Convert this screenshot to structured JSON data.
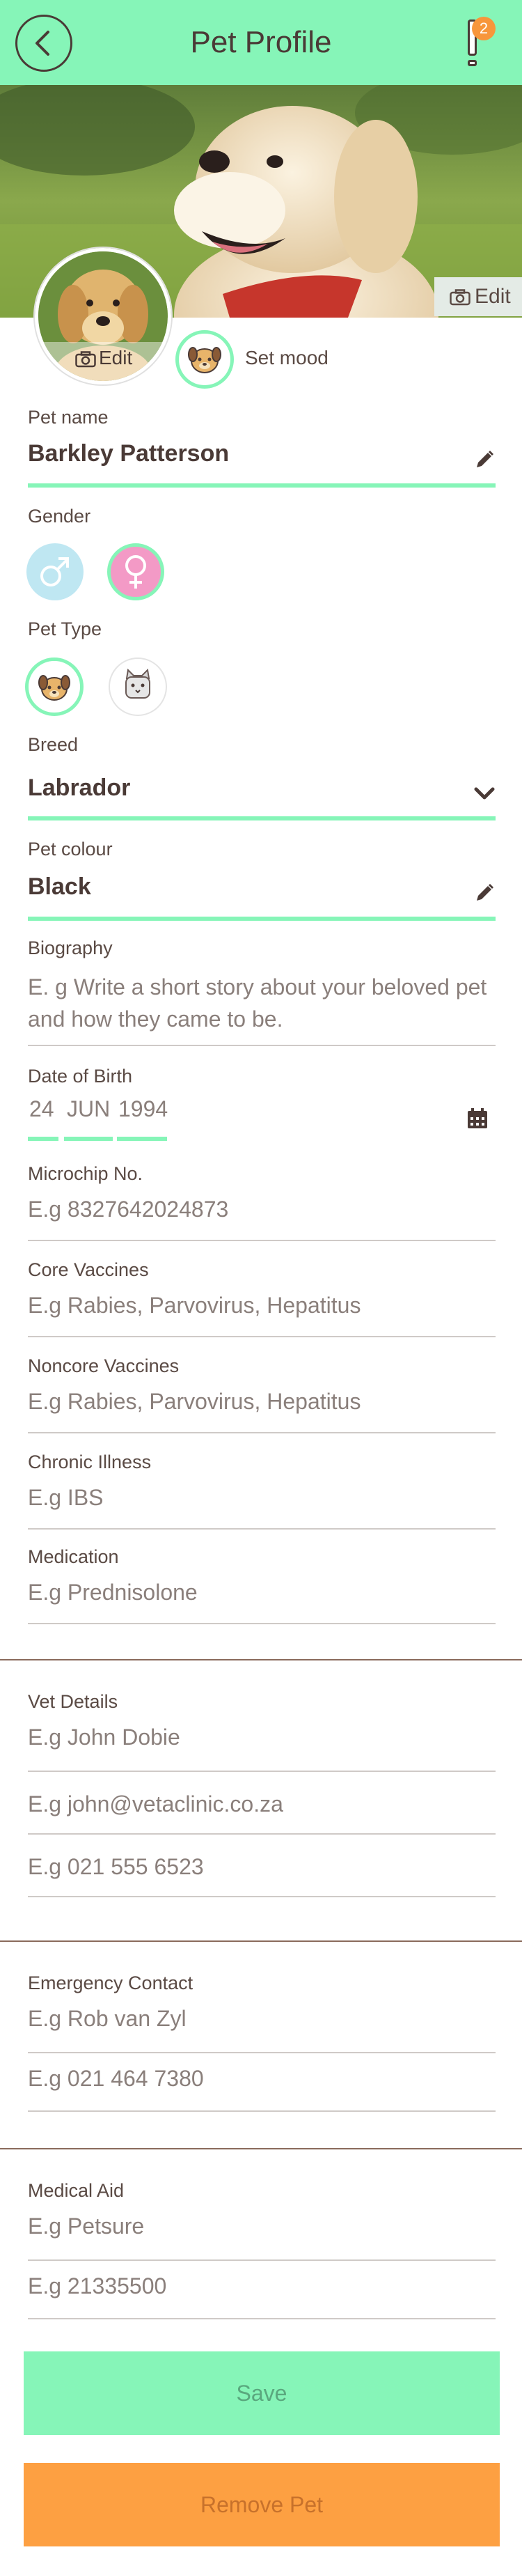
{
  "header": {
    "title": "Pet Profile",
    "alert_count": "2",
    "back_icon": "chevron-left-icon",
    "alert_icon": "exclamation-icon"
  },
  "banner": {
    "edit_label": "Edit"
  },
  "avatar": {
    "edit_label": "Edit"
  },
  "mood": {
    "label": "Set mood"
  },
  "fields": {
    "pet_name": {
      "label": "Pet name",
      "value": "Barkley Patterson"
    },
    "gender": {
      "label": "Gender",
      "selected": "female"
    },
    "pet_type": {
      "label": "Pet Type",
      "selected": "dog"
    },
    "breed": {
      "label": "Breed",
      "value": "Labrador"
    },
    "colour": {
      "label": "Pet colour",
      "value": "Black"
    },
    "biography": {
      "label": "Biography",
      "placeholder": "E. g Write a short story about your beloved pet and how they came to be."
    },
    "dob": {
      "label": "Date of Birth",
      "day": "24",
      "month": "JUN",
      "year": "1994"
    },
    "microchip": {
      "label": "Microchip No.",
      "placeholder": "E.g 8327642024873"
    },
    "core_vaccines": {
      "label": "Core Vaccines",
      "placeholder": "E.g Rabies, Parvovirus, Hepatitus"
    },
    "noncore_vaccines": {
      "label": "Noncore Vaccines",
      "placeholder": "E.g Rabies, Parvovirus, Hepatitus"
    },
    "chronic_illness": {
      "label": "Chronic Illness",
      "placeholder": "E.g IBS"
    },
    "medication": {
      "label": "Medication",
      "placeholder": "E.g Prednisolone"
    }
  },
  "vet": {
    "label": "Vet Details",
    "name_placeholder": "E.g John Dobie",
    "email_placeholder": "E.g john@vetaclinic.co.za",
    "phone_placeholder": "E.g 021 555 6523"
  },
  "emergency": {
    "label": "Emergency Contact",
    "name_placeholder": "E.g Rob van Zyl",
    "phone_placeholder": "E.g 021 464 7380"
  },
  "medical_aid": {
    "label": "Medical Aid",
    "provider_placeholder": "E.g Petsure",
    "number_placeholder": "E.g 21335500"
  },
  "buttons": {
    "save": "Save",
    "remove": "Remove Pet"
  },
  "colors": {
    "accent": "#86f5b8",
    "danger": "#fda042",
    "badge": "#f7963b",
    "text": "#5a4a44"
  }
}
